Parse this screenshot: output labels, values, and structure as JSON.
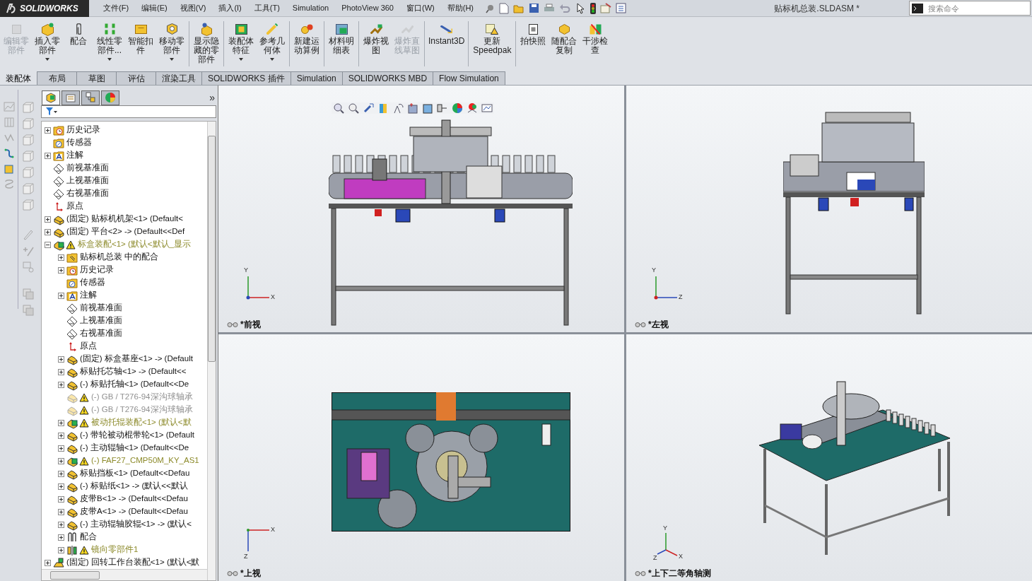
{
  "app": {
    "logo": "SOLIDWORKS",
    "title": "贴标机总装.SLDASM *",
    "search": {
      "placeholder": "搜索命令"
    }
  },
  "menu": [
    "文件(F)",
    "编辑(E)",
    "视图(V)",
    "插入(I)",
    "工具(T)",
    "Simulation",
    "PhotoView 360",
    "窗口(W)",
    "帮助(H)"
  ],
  "toolbar": {
    "groups": [
      {
        "buttons": [
          {
            "label": "编辑零部件",
            "disabled": true,
            "dropdown": false
          },
          {
            "label": "插入零部件",
            "disabled": false,
            "dropdown": true
          },
          {
            "label": "配合",
            "disabled": false,
            "dropdown": false
          },
          {
            "label": "线性零部件...",
            "disabled": false,
            "dropdown": true
          },
          {
            "label": "智能扣件",
            "disabled": false,
            "dropdown": false
          },
          {
            "label": "移动零部件",
            "disabled": false,
            "dropdown": true
          }
        ]
      },
      {
        "buttons": [
          {
            "label": "显示隐藏的零部件",
            "disabled": false,
            "dropdown": false
          }
        ]
      },
      {
        "buttons": [
          {
            "label": "装配体特征",
            "disabled": false,
            "dropdown": true
          },
          {
            "label": "参考几何体",
            "disabled": false,
            "dropdown": true
          }
        ]
      },
      {
        "buttons": [
          {
            "label": "新建运动算例",
            "disabled": false,
            "dropdown": false
          }
        ]
      },
      {
        "buttons": [
          {
            "label": "材料明细表",
            "disabled": false,
            "dropdown": false
          }
        ]
      },
      {
        "buttons": [
          {
            "label": "爆炸视图",
            "disabled": false,
            "dropdown": false
          },
          {
            "label": "爆炸直线草图",
            "disabled": true,
            "dropdown": false
          }
        ]
      },
      {
        "buttons": [
          {
            "label": "Instant3D",
            "disabled": false,
            "dropdown": false
          }
        ]
      },
      {
        "buttons": [
          {
            "label": "更新 Speedpak",
            "disabled": false,
            "dropdown": false
          }
        ]
      },
      {
        "buttons": [
          {
            "label": "拍快照",
            "disabled": false,
            "dropdown": false
          },
          {
            "label": "随配合复制",
            "disabled": false,
            "dropdown": false
          },
          {
            "label": "干涉检查",
            "disabled": false,
            "dropdown": false
          }
        ]
      }
    ]
  },
  "tabs": [
    {
      "label": "装配体",
      "selected": true
    },
    {
      "label": "布局",
      "selected": false
    },
    {
      "label": "草图",
      "selected": false
    },
    {
      "label": "评估",
      "selected": false
    },
    {
      "label": "渲染工具",
      "selected": false
    },
    {
      "label": "SOLIDWORKS 插件",
      "selected": false
    },
    {
      "label": "Simulation",
      "selected": false
    },
    {
      "label": "SOLIDWORKS MBD",
      "selected": false
    },
    {
      "label": "Flow Simulation",
      "selected": false
    }
  ],
  "panel": {
    "tabs": [
      {
        "selected": true
      },
      {
        "selected": false
      },
      {
        "selected": false
      },
      {
        "selected": false
      }
    ],
    "more": "»",
    "tree": [
      {
        "label": "历史记录",
        "kind": "history",
        "expanded": false,
        "warning": false,
        "suppressed": false
      },
      {
        "label": "传感器",
        "kind": "sensor",
        "warning": false,
        "suppressed": false
      },
      {
        "label": "注解",
        "kind": "annotation",
        "expanded": false,
        "warning": false,
        "suppressed": false
      },
      {
        "label": "前视基准面",
        "kind": "plane",
        "warning": false,
        "suppressed": false
      },
      {
        "label": "上视基准面",
        "kind": "plane",
        "warning": false,
        "suppressed": false
      },
      {
        "label": "右视基准面",
        "kind": "plane",
        "warning": false,
        "suppressed": false
      },
      {
        "label": "原点",
        "kind": "origin",
        "warning": false,
        "suppressed": false
      },
      {
        "label": "(固定) 贴标机机架<1> (Default<",
        "kind": "part",
        "expanded": false,
        "warning": false,
        "suppressed": false
      },
      {
        "label": "(固定) 平台<2> -> (Default<<Def",
        "kind": "part",
        "expanded": false,
        "warning": false,
        "suppressed": false
      },
      {
        "label": "标盒装配<1> (默认<默认_显示",
        "kind": "assembly",
        "expanded": true,
        "warning": true,
        "suppressed": false,
        "children": [
          {
            "label": "贴标机总装 中的配合",
            "kind": "mates_folder",
            "expanded": false,
            "warning": false,
            "suppressed": false
          },
          {
            "label": "历史记录",
            "kind": "history",
            "expanded": false,
            "warning": false,
            "suppressed": false
          },
          {
            "label": "传感器",
            "kind": "sensor",
            "warning": false,
            "suppressed": false
          },
          {
            "label": "注解",
            "kind": "annotation",
            "expanded": false,
            "warning": false,
            "suppressed": false
          },
          {
            "label": "前视基准面",
            "kind": "plane",
            "warning": false,
            "suppressed": false
          },
          {
            "label": "上视基准面",
            "kind": "plane",
            "warning": false,
            "suppressed": false
          },
          {
            "label": "右视基准面",
            "kind": "plane",
            "warning": false,
            "suppressed": false
          },
          {
            "label": "原点",
            "kind": "origin",
            "warning": false,
            "suppressed": false
          },
          {
            "label": "(固定) 标盒基座<1> -> (Default",
            "kind": "part",
            "expanded": false,
            "warning": false,
            "suppressed": false
          },
          {
            "label": "标贴托芯轴<1> -> (Default<<",
            "kind": "part",
            "expanded": false,
            "warning": false,
            "suppressed": false
          },
          {
            "label": "(-) 标贴托轴<1> (Default<<De",
            "kind": "part",
            "expanded": false,
            "warning": false,
            "suppressed": false
          },
          {
            "label": "(-) GB / T276-94深沟球轴承",
            "kind": "part",
            "warning": true,
            "suppressed": true
          },
          {
            "label": "(-) GB / T276-94深沟球轴承",
            "kind": "part",
            "warning": true,
            "suppressed": true
          },
          {
            "label": "被动托辊装配<1> (默认<默",
            "kind": "assembly",
            "expanded": false,
            "warning": true,
            "suppressed": false
          },
          {
            "label": "(-) 带轮被动棍带轮<1> (Default",
            "kind": "part",
            "expanded": false,
            "warning": false,
            "suppressed": false
          },
          {
            "label": "(-) 主动辊轴<1> (Default<<De",
            "kind": "part",
            "expanded": false,
            "warning": false,
            "suppressed": false
          },
          {
            "label": "(-) FAF27_CMP50M_KY_AS1",
            "kind": "assembly",
            "expanded": false,
            "warning": true,
            "suppressed": false
          },
          {
            "label": "标贴挡板<1> (Default<<Defau",
            "kind": "part",
            "expanded": false,
            "warning": false,
            "suppressed": false
          },
          {
            "label": "(-) 标贴纸<1> -> (默认<<默认",
            "kind": "part",
            "expanded": false,
            "warning": false,
            "suppressed": false
          },
          {
            "label": "皮带B<1> -> (Default<<Defau",
            "kind": "part",
            "expanded": false,
            "warning": false,
            "suppressed": false
          },
          {
            "label": "皮带A<1> -> (Default<<Defau",
            "kind": "part",
            "expanded": false,
            "warning": false,
            "suppressed": false
          },
          {
            "label": "(-) 主动辊轴胶辊<1> -> (默认<",
            "kind": "part",
            "expanded": false,
            "warning": false,
            "suppressed": false
          },
          {
            "label": "配合",
            "kind": "mates",
            "expanded": false,
            "warning": false,
            "suppressed": false
          },
          {
            "label": "镜向零部件1",
            "kind": "mirror",
            "expanded": false,
            "warning": true,
            "suppressed": false
          }
        ]
      },
      {
        "label": "(固定) 回转工作台装配<1> (默认<默",
        "kind": "rotary_assembly",
        "expanded": false,
        "warning": false,
        "suppressed": false
      }
    ]
  },
  "viewports": [
    {
      "label": "*前视",
      "kind": "front",
      "axes": [
        "Y",
        "X"
      ]
    },
    {
      "label": "*左视",
      "kind": "left",
      "axes": [
        "Y",
        "Z"
      ]
    },
    {
      "label": "*上视",
      "kind": "top",
      "axes": [
        "X",
        "Z"
      ]
    },
    {
      "label": "*上下二等角轴测",
      "kind": "iso",
      "axes": [
        "Y",
        "Z",
        "X"
      ]
    }
  ]
}
